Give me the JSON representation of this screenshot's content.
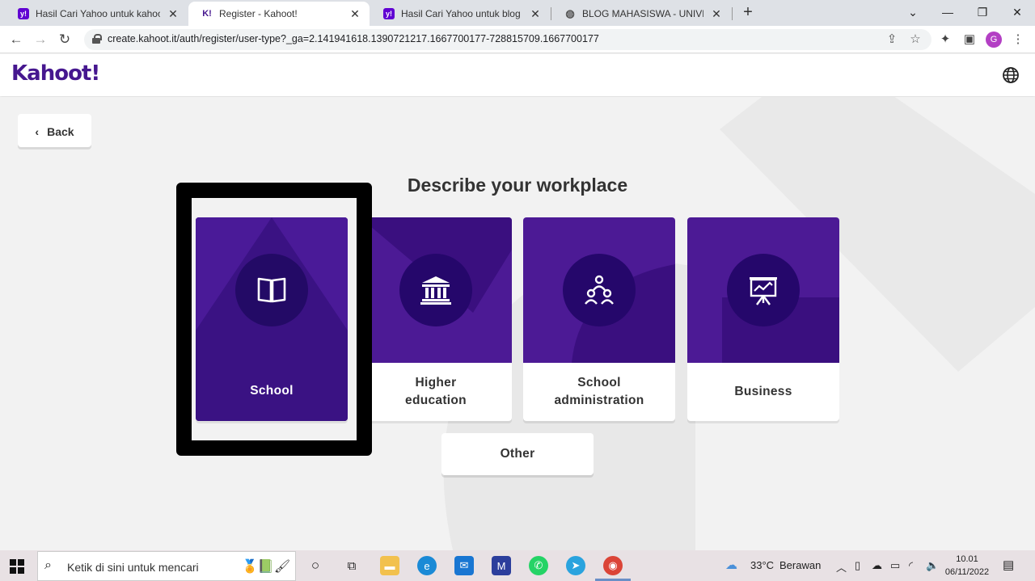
{
  "browser": {
    "tabs": [
      {
        "title": "Hasil Cari Yahoo untuk kahoot",
        "icon": "yahoo-favicon",
        "active": false
      },
      {
        "title": "Register - Kahoot!",
        "icon": "kahoot-favicon",
        "active": true
      },
      {
        "title": "Hasil Cari Yahoo untuk blog mah",
        "icon": "yahoo-favicon",
        "active": false
      },
      {
        "title": "BLOG MAHASISWA - UNIVERSITA",
        "icon": "globe-favicon",
        "active": false
      }
    ],
    "url": "create.kahoot.it/auth/register/user-type?_ga=2.141941618.1390721217.1667700177-728815709.1667700177",
    "profile_initial": "G"
  },
  "kahoot": {
    "logo": "Kahoot!",
    "back_label": "Back",
    "heading": "Describe your workplace",
    "options": [
      {
        "label": "School",
        "icon": "book-icon",
        "selected": true
      },
      {
        "label": "Higher education",
        "icon": "institution-icon",
        "selected": false
      },
      {
        "label": "School administration",
        "icon": "people-group-icon",
        "selected": false
      },
      {
        "label": "Business",
        "icon": "presentation-board-icon",
        "selected": false
      }
    ],
    "other_label": "Other"
  },
  "taskbar": {
    "search_placeholder": "Ketik di sini untuk mencari",
    "weather_temp": "33°C",
    "weather_desc": "Berawan",
    "time": "10.01",
    "date": "06/11/2022"
  }
}
